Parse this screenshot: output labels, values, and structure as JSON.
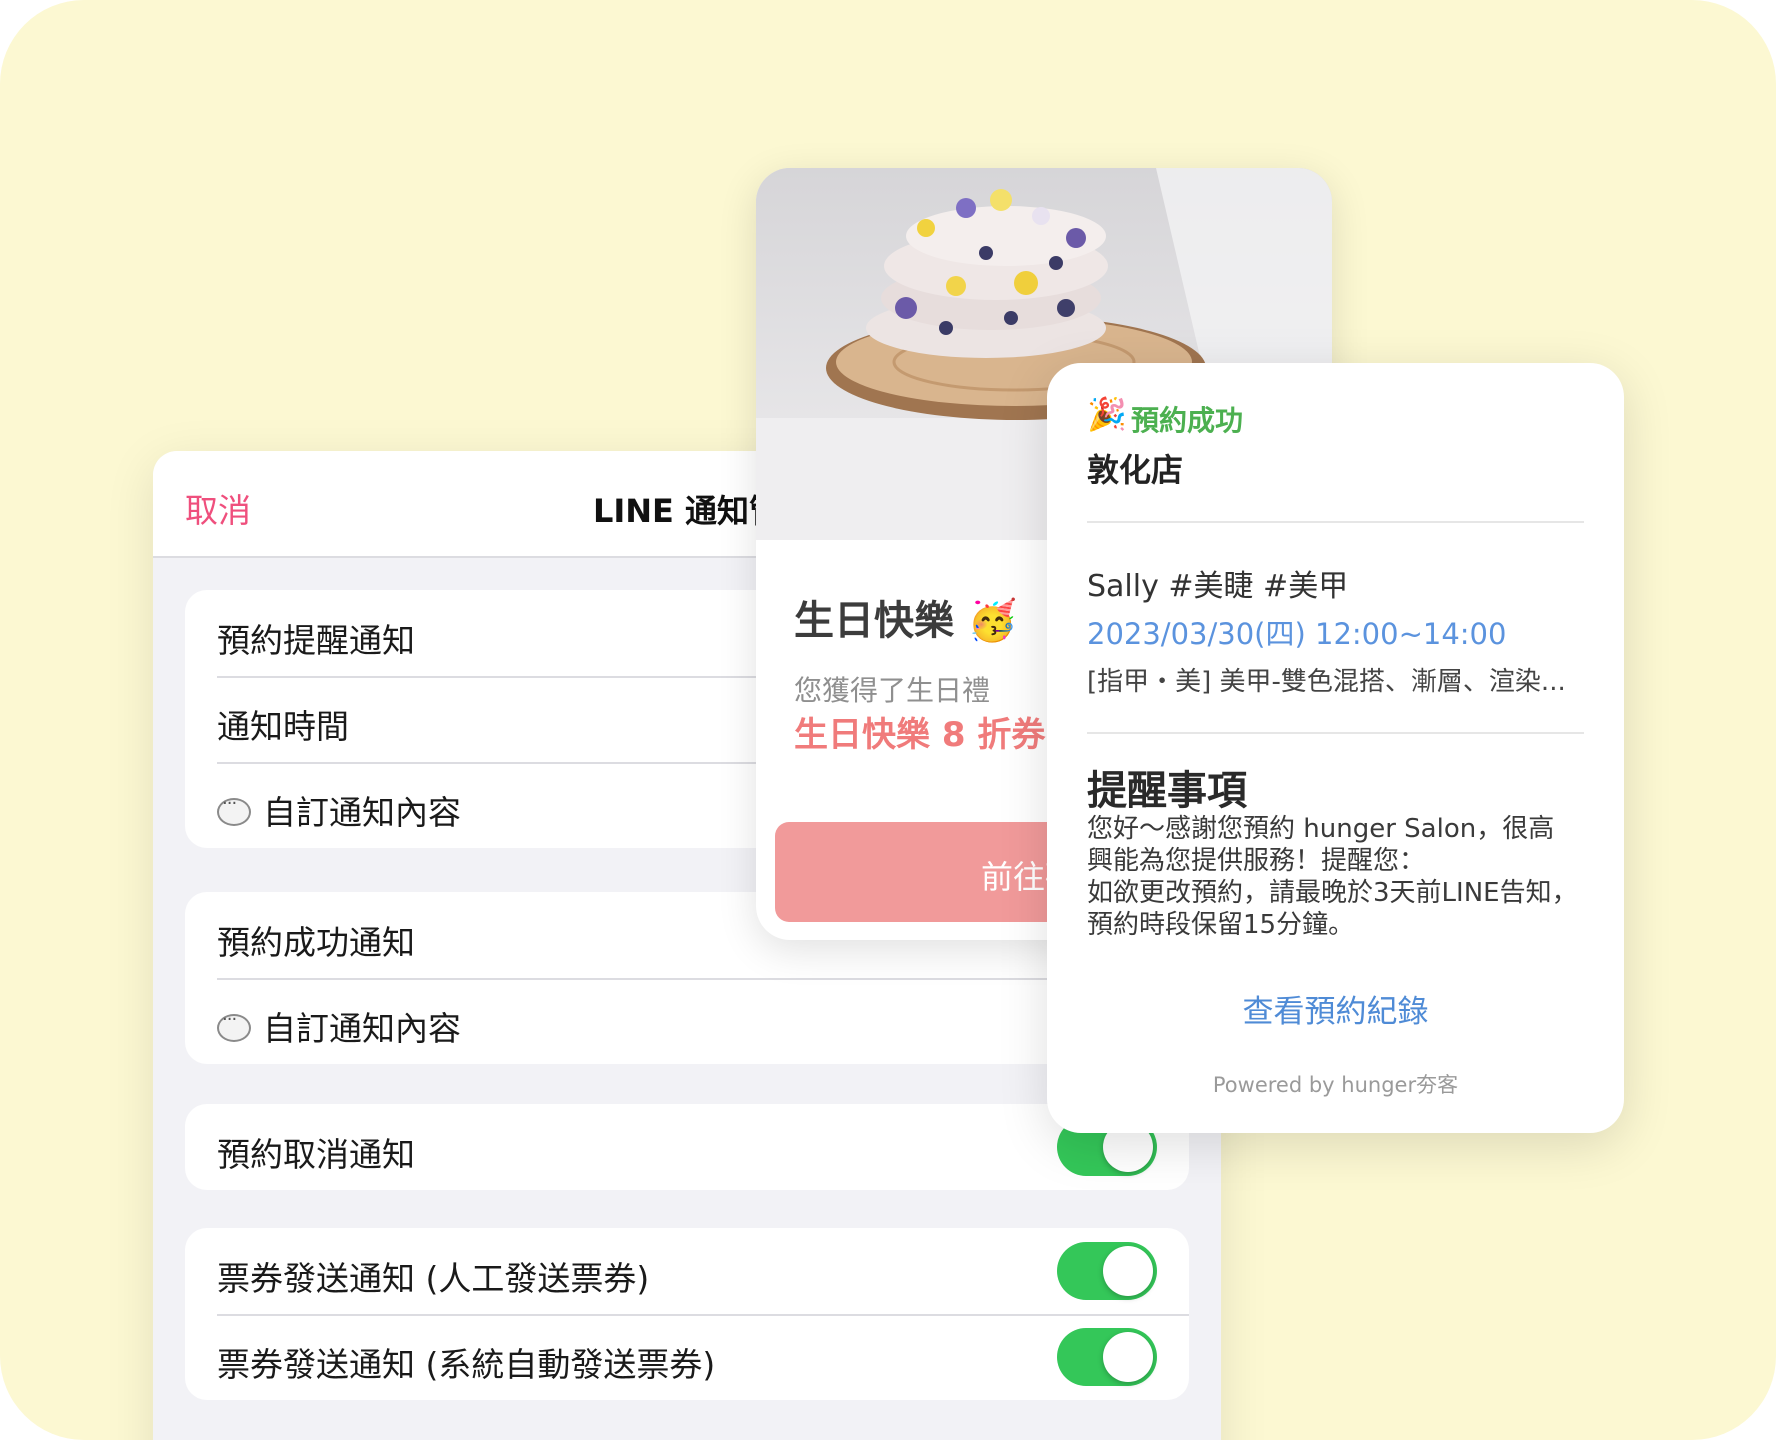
{
  "settings": {
    "cancel_label": "取消",
    "title": "LINE 通知管",
    "groups": [
      {
        "rows": [
          {
            "label": "預約提醒通知"
          },
          {
            "label": "通知時間"
          },
          {
            "label": "自訂通知內容",
            "icon": "chat-bubble-icon"
          }
        ]
      },
      {
        "rows": [
          {
            "label": "預約成功通知"
          },
          {
            "label": "自訂通知內容",
            "icon": "chat-bubble-icon"
          }
        ]
      },
      {
        "rows": [
          {
            "label": "預約取消通知",
            "toggle_on": true
          }
        ]
      },
      {
        "rows": [
          {
            "label": "票券發送通知 (人工發送票券)",
            "toggle_on": true
          },
          {
            "label": "票券發送通知 (系統自動發送票券)",
            "toggle_on": true
          }
        ]
      }
    ],
    "toggle_color": "#34c759",
    "cancel_color": "#ef4f7d"
  },
  "birthday_card": {
    "title": "生日快樂 🥳",
    "subtitle": "您獲得了生日禮",
    "coupon": "生日快樂 8 折券",
    "button_label": "前往確認",
    "button_color": "#f19a9a"
  },
  "booking_card": {
    "status_icon": "🎉",
    "status": "預約成功",
    "store": "敦化店",
    "staff_tags": "Sally #美睫 #美甲",
    "datetime": "2023/03/30(四) 12:00~14:00",
    "service": "[指甲・美] 美甲-雙色混搭、漸層、渲染...",
    "notes_title": "提醒事項",
    "notes_lines": [
      "您好～感謝您預約 hunger Salon，很高",
      "興能為您提供服務！提醒您：",
      "如欲更改預約，請最晚於3天前LINE告知，",
      "預約時段保留15分鐘。"
    ],
    "history_link": "查看預約紀錄",
    "powered_by": "Powered by hunger夯客",
    "status_color": "#4cb050",
    "link_color": "#4f8bd6"
  }
}
